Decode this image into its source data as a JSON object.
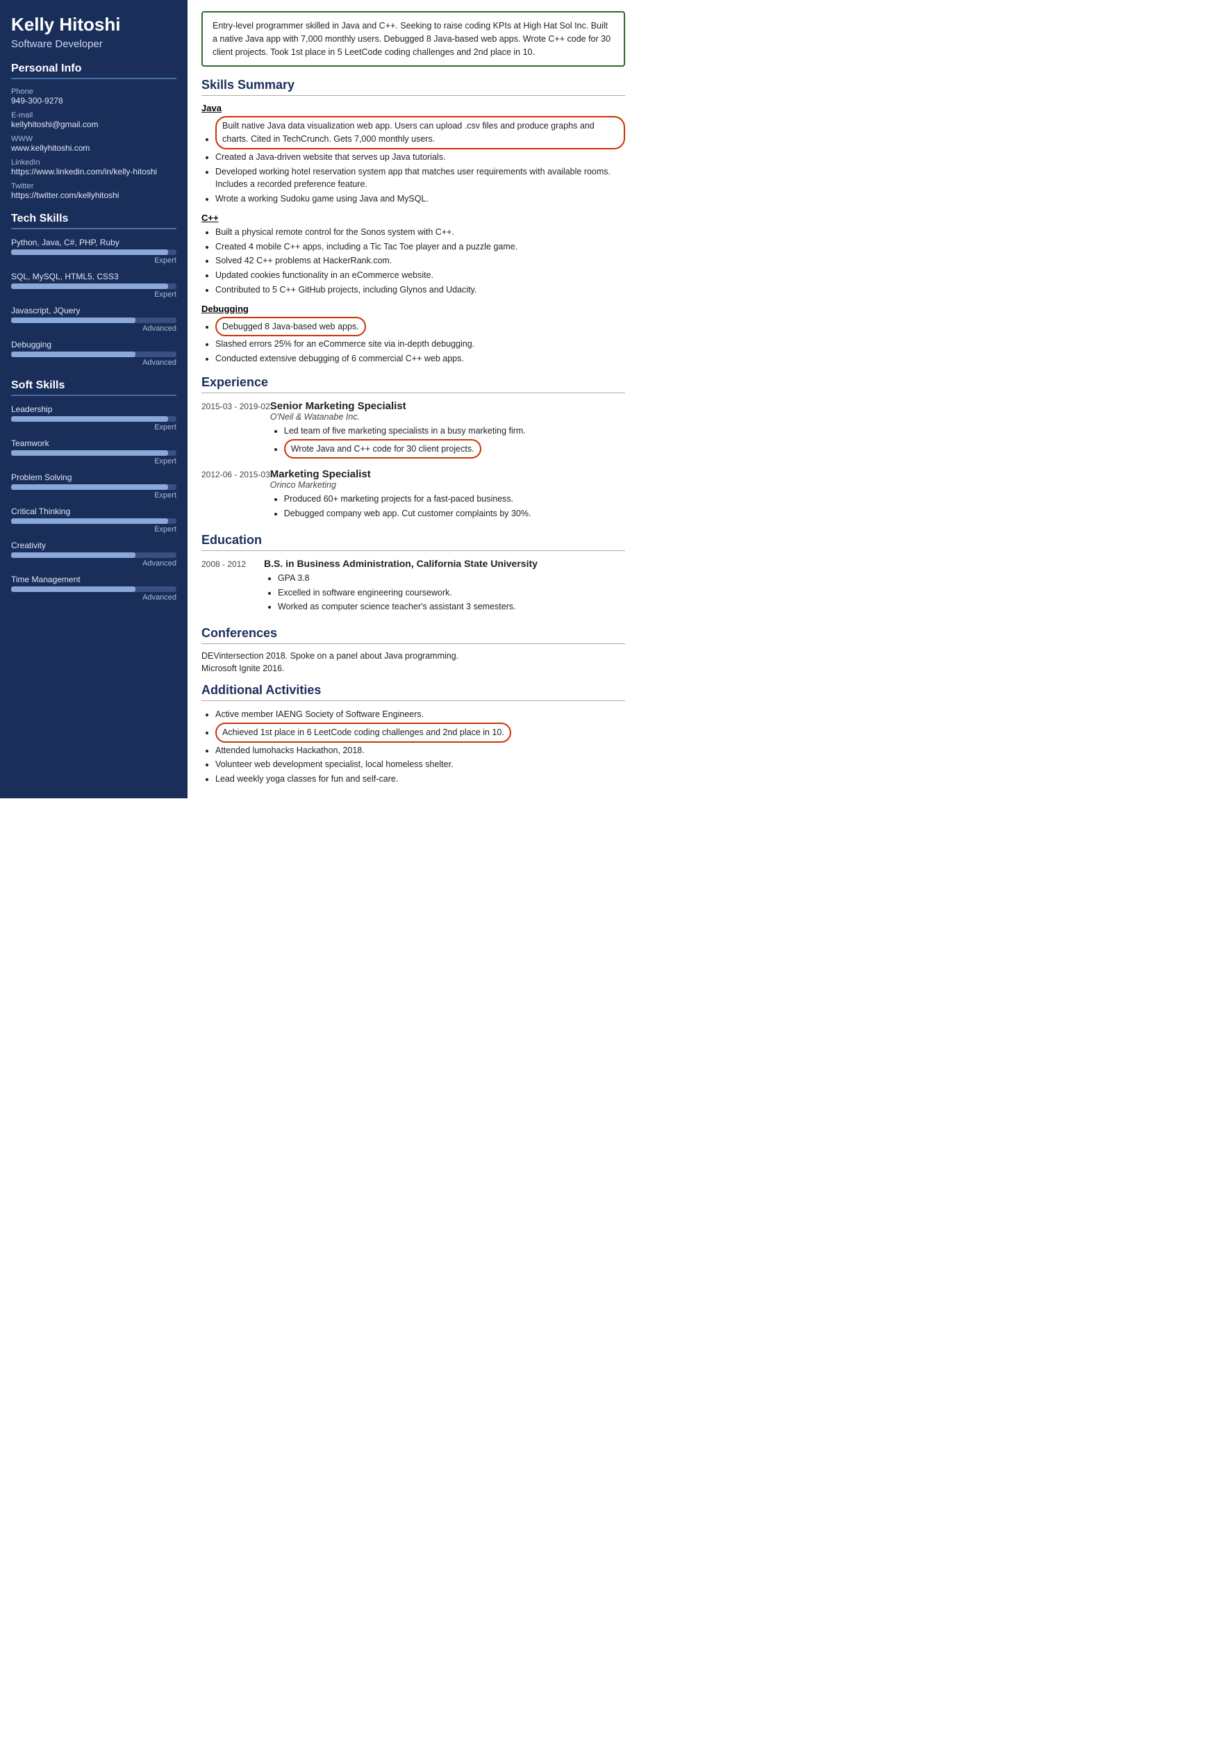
{
  "sidebar": {
    "name": "Kelly Hitoshi",
    "title": "Software Developer",
    "sections": {
      "personal_info": {
        "label": "Personal Info",
        "fields": [
          {
            "label": "Phone",
            "value": "949-300-9278"
          },
          {
            "label": "E-mail",
            "value": "kellyhitoshi@gmail.com"
          },
          {
            "label": "WWW",
            "value": "www.kellyhitoshi.com"
          },
          {
            "label": "LinkedIn",
            "value": "https://www.linkedin.com/in/kelly-hitoshi"
          },
          {
            "label": "Twitter",
            "value": "https://twitter.com/kellyhitoshi"
          }
        ]
      },
      "tech_skills": {
        "label": "Tech Skills",
        "skills": [
          {
            "name": "Python, Java, C#, PHP, Ruby",
            "percent": 95,
            "level": "Expert"
          },
          {
            "name": "SQL, MySQL, HTML5, CSS3",
            "percent": 95,
            "level": "Expert"
          },
          {
            "name": "Javascript, JQuery",
            "percent": 75,
            "level": "Advanced"
          },
          {
            "name": "Debugging",
            "percent": 75,
            "level": "Advanced"
          }
        ]
      },
      "soft_skills": {
        "label": "Soft Skills",
        "skills": [
          {
            "name": "Leadership",
            "percent": 95,
            "level": "Expert"
          },
          {
            "name": "Teamwork",
            "percent": 95,
            "level": "Expert"
          },
          {
            "name": "Problem Solving",
            "percent": 95,
            "level": "Expert"
          },
          {
            "name": "Critical Thinking",
            "percent": 95,
            "level": "Expert"
          },
          {
            "name": "Creativity",
            "percent": 75,
            "level": "Advanced"
          },
          {
            "name": "Time Management",
            "percent": 75,
            "level": "Advanced"
          }
        ]
      }
    }
  },
  "main": {
    "summary": "Entry-level programmer skilled in Java and C++. Seeking to raise coding KPIs at High Hat Sol Inc. Built a native Java app with 7,000 monthly users. Debugged 8 Java-based web apps. Wrote C++ code for 30 client projects. Took 1st place in 5 LeetCode coding challenges and 2nd place in 10.",
    "skills_summary": {
      "title": "Skills Summary",
      "categories": [
        {
          "name": "Java",
          "bullets": [
            {
              "text": "Built native Java data visualization web app. Users can upload .csv files and produce graphs and charts. Cited in TechCrunch. Gets 7,000 monthly users.",
              "highlight": true
            },
            {
              "text": "Created a Java-driven website that serves up Java tutorials.",
              "highlight": false
            },
            {
              "text": "Developed working hotel reservation system app that matches user requirements with available rooms. Includes a recorded preference feature.",
              "highlight": false
            },
            {
              "text": "Wrote a working Sudoku game using Java and MySQL.",
              "highlight": false
            }
          ]
        },
        {
          "name": "C++",
          "bullets": [
            {
              "text": "Built a physical remote control for the Sonos system with C++.",
              "highlight": false
            },
            {
              "text": "Created 4 mobile C++ apps, including a Tic Tac Toe player and a puzzle game.",
              "highlight": false
            },
            {
              "text": "Solved 42 C++ problems at HackerRank.com.",
              "highlight": false
            },
            {
              "text": "Updated cookies functionality in an eCommerce website.",
              "highlight": false
            },
            {
              "text": "Contributed to 5 C++ GitHub projects, including Glynos and Udacity.",
              "highlight": false
            }
          ]
        },
        {
          "name": "Debugging",
          "bullets": [
            {
              "text": "Debugged 8 Java-based web apps.",
              "highlight": true
            },
            {
              "text": "Slashed errors 25% for an eCommerce site via in-depth debugging.",
              "highlight": false
            },
            {
              "text": "Conducted extensive debugging of 6 commercial C++ web apps.",
              "highlight": false
            }
          ]
        }
      ]
    },
    "experience": {
      "title": "Experience",
      "items": [
        {
          "date": "2015-03 - 2019-02",
          "job_title": "Senior Marketing Specialist",
          "company": "O'Neil & Watanabe Inc.",
          "bullets": [
            {
              "text": "Led team of five marketing specialists in a busy marketing firm.",
              "highlight": false
            },
            {
              "text": "Wrote Java and C++ code for 30 client projects.",
              "highlight": true
            }
          ]
        },
        {
          "date": "2012-06 - 2015-03",
          "job_title": "Marketing Specialist",
          "company": "Orinco Marketing",
          "bullets": [
            {
              "text": "Produced 60+ marketing projects for a fast-paced business.",
              "highlight": false
            },
            {
              "text": "Debugged company web app. Cut customer complaints by 30%.",
              "highlight": false
            }
          ]
        }
      ]
    },
    "education": {
      "title": "Education",
      "items": [
        {
          "date": "2008 - 2012",
          "degree": "B.S. in Business Administration, California State University",
          "bullets": [
            "GPA 3.8",
            "Excelled in software engineering coursework.",
            "Worked as computer science teacher's assistant 3 semesters."
          ]
        }
      ]
    },
    "conferences": {
      "title": "Conferences",
      "items": [
        "DEVintersection 2018. Spoke on a panel about Java programming.",
        "Microsoft Ignite 2016."
      ]
    },
    "additional_activities": {
      "title": "Additional Activities",
      "bullets": [
        {
          "text": "Active member IAENG Society of Software Engineers.",
          "highlight": false
        },
        {
          "text": "Achieved 1st place in 6 LeetCode coding challenges and 2nd place in 10.",
          "highlight": true
        },
        {
          "text": "Attended lumohacks Hackathon, 2018.",
          "highlight": false
        },
        {
          "text": "Volunteer web development specialist, local homeless shelter.",
          "highlight": false
        },
        {
          "text": "Lead weekly yoga classes for fun and self-care.",
          "highlight": false
        }
      ]
    }
  }
}
